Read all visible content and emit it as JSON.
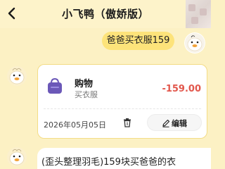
{
  "header": {
    "title": "小飞鸭（傲娇版）",
    "back_icon": "chevron-left-icon"
  },
  "messages": {
    "user_text": "爸爸买衣服159",
    "bot_reply_text": "(歪头整理羽毛)159块买爸爸的衣"
  },
  "record_card": {
    "category": "购物",
    "note": "买衣服",
    "amount": "-159.00",
    "date": "2026年05月05日",
    "edit_label": "编辑",
    "category_icon": "shopping-bag-icon",
    "delete_icon": "trash-icon",
    "edit_icon": "pencil-icon"
  },
  "colors": {
    "background": "#fcf1c4",
    "user_bubble": "#fde37a",
    "card_border": "#f3dc86",
    "amount": "#e2574c",
    "bag": "#6b58b8"
  }
}
